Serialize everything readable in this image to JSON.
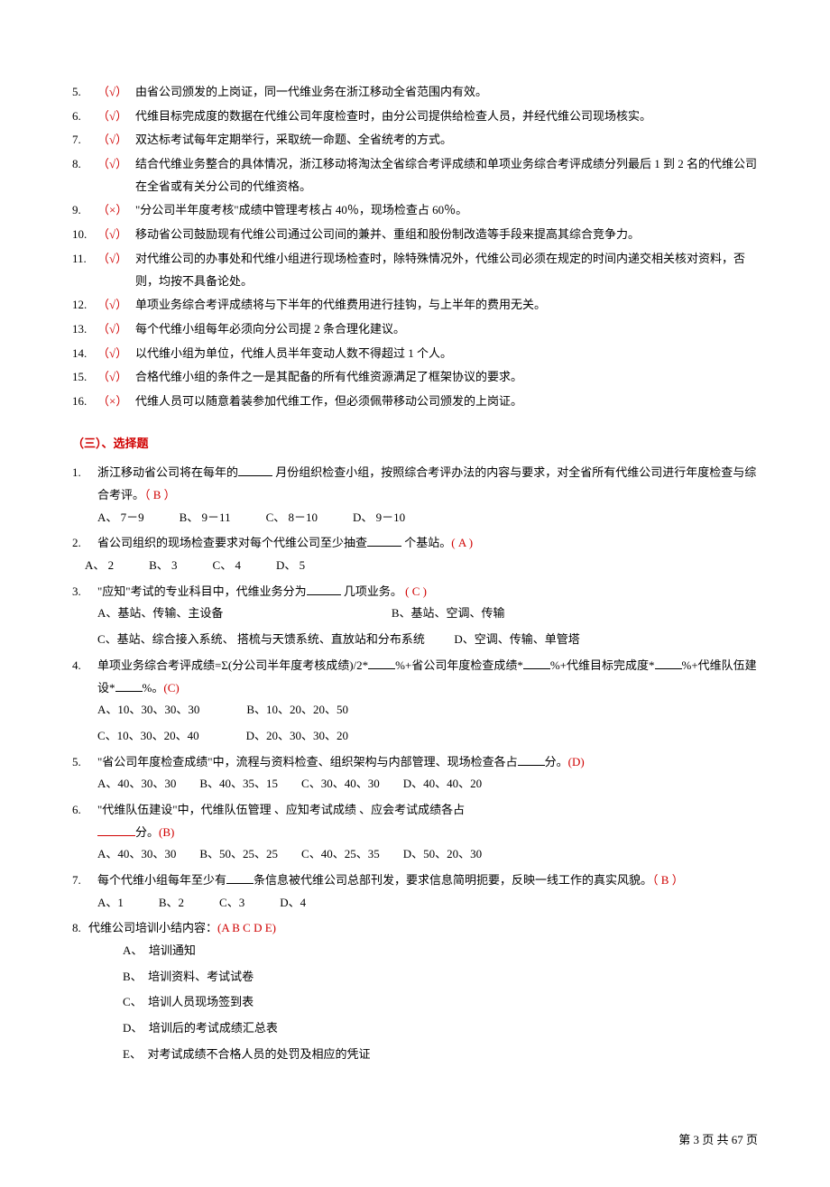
{
  "tf": [
    {
      "n": "5.",
      "mark": "（√）",
      "text": "由省公司颁发的上岗证，同一代维业务在浙江移动全省范围内有效。"
    },
    {
      "n": "6.",
      "mark": "（√）",
      "text": "代维目标完成度的数据在代维公司年度检查时，由分公司提供给检查人员，并经代维公司现场核实。"
    },
    {
      "n": "7.",
      "mark": "（√）",
      "text": "双达标考试每年定期举行，采取统一命题、全省统考的方式。"
    },
    {
      "n": "8.",
      "mark": "（√）",
      "text": "结合代维业务整合的具体情况，浙江移动将淘汰全省综合考评成绩和单项业务综合考评成绩分列最后 1 到 2 名的代维公司在全省或有关分公司的代维资格。"
    },
    {
      "n": "9.",
      "mark": "（×）",
      "text": "\"分公司半年度考核\"成绩中管理考核占 40％，现场检查占 60％。"
    },
    {
      "n": "10.",
      "mark": "（√）",
      "text": "移动省公司鼓励现有代维公司通过公司间的兼并、重组和股份制改造等手段来提高其综合竞争力。"
    },
    {
      "n": "11.",
      "mark": "（√）",
      "text": "对代维公司的办事处和代维小组进行现场检查时，除特殊情况外，代维公司必须在规定的时间内递交相关核对资料，否则，均按不具备论处。"
    },
    {
      "n": "12.",
      "mark": "（√）",
      "text": "单项业务综合考评成绩将与下半年的代维费用进行挂钩，与上半年的费用无关。"
    },
    {
      "n": "13.",
      "mark": "（√）",
      "text": "每个代维小组每年必须向分公司提 2 条合理化建议。"
    },
    {
      "n": "14.",
      "mark": "（√）",
      "text": "以代维小组为单位，代维人员半年变动人数不得超过 1 个人。"
    },
    {
      "n": "15.",
      "mark": "（√）",
      "text": "合格代维小组的条件之一是其配备的所有代维资源满足了框架协议的要求。"
    },
    {
      "n": "16.",
      "mark": "（×）",
      "text": "代维人员可以随意着装参加代维工作，但必须佩带移动公司颁发的上岗证。"
    }
  ],
  "section_title": "（三）、选择题",
  "mc": {
    "q1": {
      "n": "1.",
      "pre": "浙江移动省公司将在每年的",
      "post": " 月份组织检查小组，按照综合考评办法的内容与要求，对全省所有代维公司进行年度检查与综合考评。",
      "ans": "（ B ）",
      "opts": "A、 7－9　　　B、 9－11　　　C、 8－10　　　D、 9－10"
    },
    "q2": {
      "n": "2.",
      "pre": "省公司组织的现场检查要求对每个代维公司至少抽查",
      "post": " 个基站。",
      "ans": "( A )",
      "opts": "A、 2　　　B、 3　　　C、 4　　　D、 5"
    },
    "q3": {
      "n": "3.",
      "pre": "\"应知\"考试的专业科目中，代维业务分为",
      "post": " 几项业务。 ",
      "ans": "( C )",
      "opts_a": "A、基站、传输、主设备",
      "opts_b": "B、基站、空调、传输",
      "opts_c": "C、基站、综合接入系统、 搭梳与天馈系统、直放站和分布系统",
      "opts_d": "D、空调、传输、单管塔"
    },
    "q4": {
      "n": "4.",
      "t1": "单项业务综合考评成绩=Σ(分公司半年度考核成绩)/2*",
      "t2": "%+省公司年度检查成绩*",
      "t3": "%+代维目标完成度*",
      "t4": "%+代维队伍建设*",
      "t5": "%。",
      "ans": "(C)",
      "opts1": "A、10、30、30、30　　　　B、10、20、20、50",
      "opts2": "C、10、30、20、40　　　　D、20、30、30、20"
    },
    "q5": {
      "n": "5.",
      "pre": "\"省公司年度检查成绩\"中，流程与资料检查、组织架构与内部管理、现场检查各占",
      "post": "分。",
      "ans": "(D)",
      "opts": "A、40、30、30　　B、40、35、15　　C、30、40、30　　D、40、40、20"
    },
    "q6": {
      "n": "6.",
      "line1": "\"代维队伍建设\"中，代维队伍管理 、应知考试成绩 、应会考试成绩各占",
      "post": "分。",
      "ans": "(B)",
      "opts": "A、40、30、30　　B、50、25、25　　C、40、25、35　　D、50、20、30"
    },
    "q7": {
      "n": "7.",
      "pre": "每个代维小组每年至少有",
      "post": "条信息被代维公司总部刊发，要求信息简明扼要，反映一线工作的真实风貌。",
      "ans": "（ B ）",
      "opts": "A、1　　　B、2　　　C、3　　　D、4"
    },
    "q8": {
      "n": "8.",
      "text": "代维公司培训小结内容：",
      "ans": "(A B C D E)",
      "a": "A、　培训通知",
      "b": "B、　培训资料、考试试卷",
      "c": "C、　培训人员现场签到表",
      "d": "D、　培训后的考试成绩汇总表",
      "e": "E、　对考试成绩不合格人员的处罚及相应的凭证"
    }
  },
  "footer": "第 3 页 共 67 页"
}
